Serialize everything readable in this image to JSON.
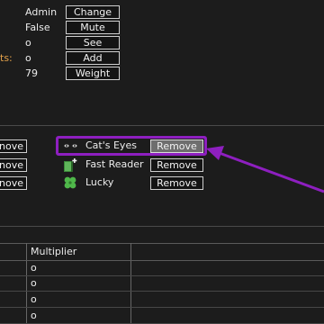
{
  "stats": {
    "rows": [
      {
        "prefix": "",
        "value": "Admin",
        "button": "Change"
      },
      {
        "prefix": "",
        "value": "False",
        "button": "Mute"
      },
      {
        "prefix": "",
        "value": "o",
        "button": "See"
      },
      {
        "prefix": "ts:",
        "value": "o",
        "button": "Add"
      },
      {
        "prefix": "",
        "value": "79",
        "button": "Weight"
      }
    ],
    "prefix_color": "#e3a14a"
  },
  "left_remove_buttons": [
    "nove",
    "nove",
    "nove"
  ],
  "traits": [
    {
      "name": "Cat's Eyes",
      "button": "Remove",
      "icon": "cat-eyes-icon",
      "highlighted": true
    },
    {
      "name": "Fast Reader",
      "button": "Remove",
      "icon": "book-plus-icon",
      "highlighted": false
    },
    {
      "name": "Lucky",
      "button": "Remove",
      "icon": "four-leaf-clover-icon",
      "highlighted": false
    }
  ],
  "highlight_color": "#8e1fc0",
  "table": {
    "header": "Multiplier",
    "rows": [
      "o",
      "o",
      "o",
      "o"
    ]
  }
}
